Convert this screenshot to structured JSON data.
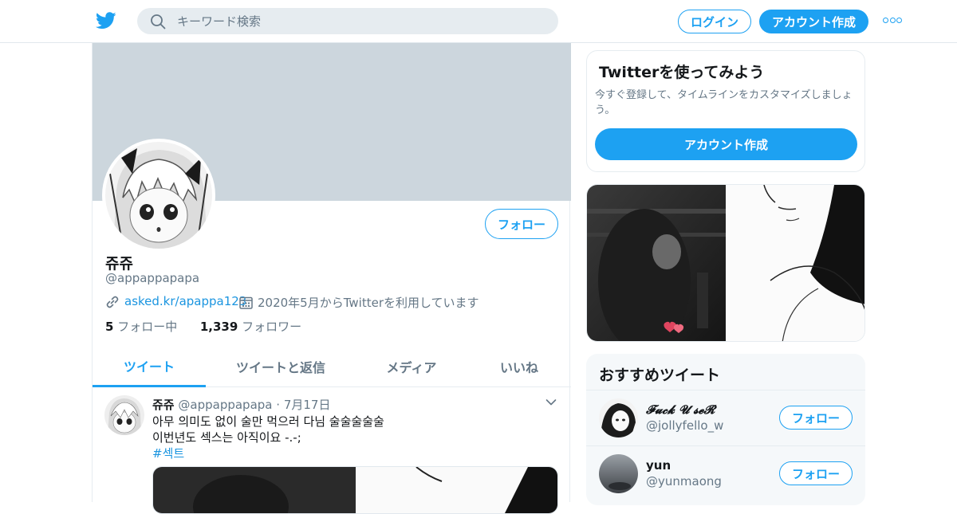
{
  "topbar": {
    "logo_icon": "twitter-bird-icon",
    "search_placeholder": "キーワード検索",
    "login_label": "ログイン",
    "signup_label": "アカウント作成",
    "more_icon": "more-dots-icon"
  },
  "profile": {
    "display_name": "쥬쥬",
    "handle": "@appappapapa",
    "link": "asked.kr/apappa123",
    "joined": "2020年5月からTwitterを利用しています",
    "follow_label": "フォロー",
    "following_count": "5",
    "following_label": "フォロー中",
    "followers_count": "1,339",
    "followers_label": "フォロワー"
  },
  "tabs": [
    {
      "label": "ツイート",
      "active": true
    },
    {
      "label": "ツイートと返信",
      "active": false
    },
    {
      "label": "メディア",
      "active": false
    },
    {
      "label": "いいね",
      "active": false
    }
  ],
  "tweet": {
    "name": "쥬쥬",
    "handle": "@appappapapa",
    "separator": "·",
    "date": "7月17日",
    "line1": "아무 의미도 없이 술만 먹으러 다님 술술술술술",
    "line2": "이번년도 섹스는 아직이요 -.-;",
    "hashtag": "#섹트"
  },
  "signup_card": {
    "title": "Twitterを使ってみよう",
    "description": "今すぐ登録して、タイムラインをカスタマイズしましょう。",
    "button_label": "アカウント作成"
  },
  "recommend": {
    "title": "おすすめツイート",
    "items": [
      {
        "name": "𝓕𝓾𝓬𝓴 𝓤 𝓼𝓮𝓡",
        "handle": "@jollyfello_w",
        "follow_label": "フォロー"
      },
      {
        "name": "yun",
        "handle": "@yunmaong",
        "follow_label": "フォロー"
      }
    ]
  },
  "colors": {
    "accent": "#1da1f2",
    "banner": "#ccd6dd",
    "muted_text": "#657786"
  }
}
